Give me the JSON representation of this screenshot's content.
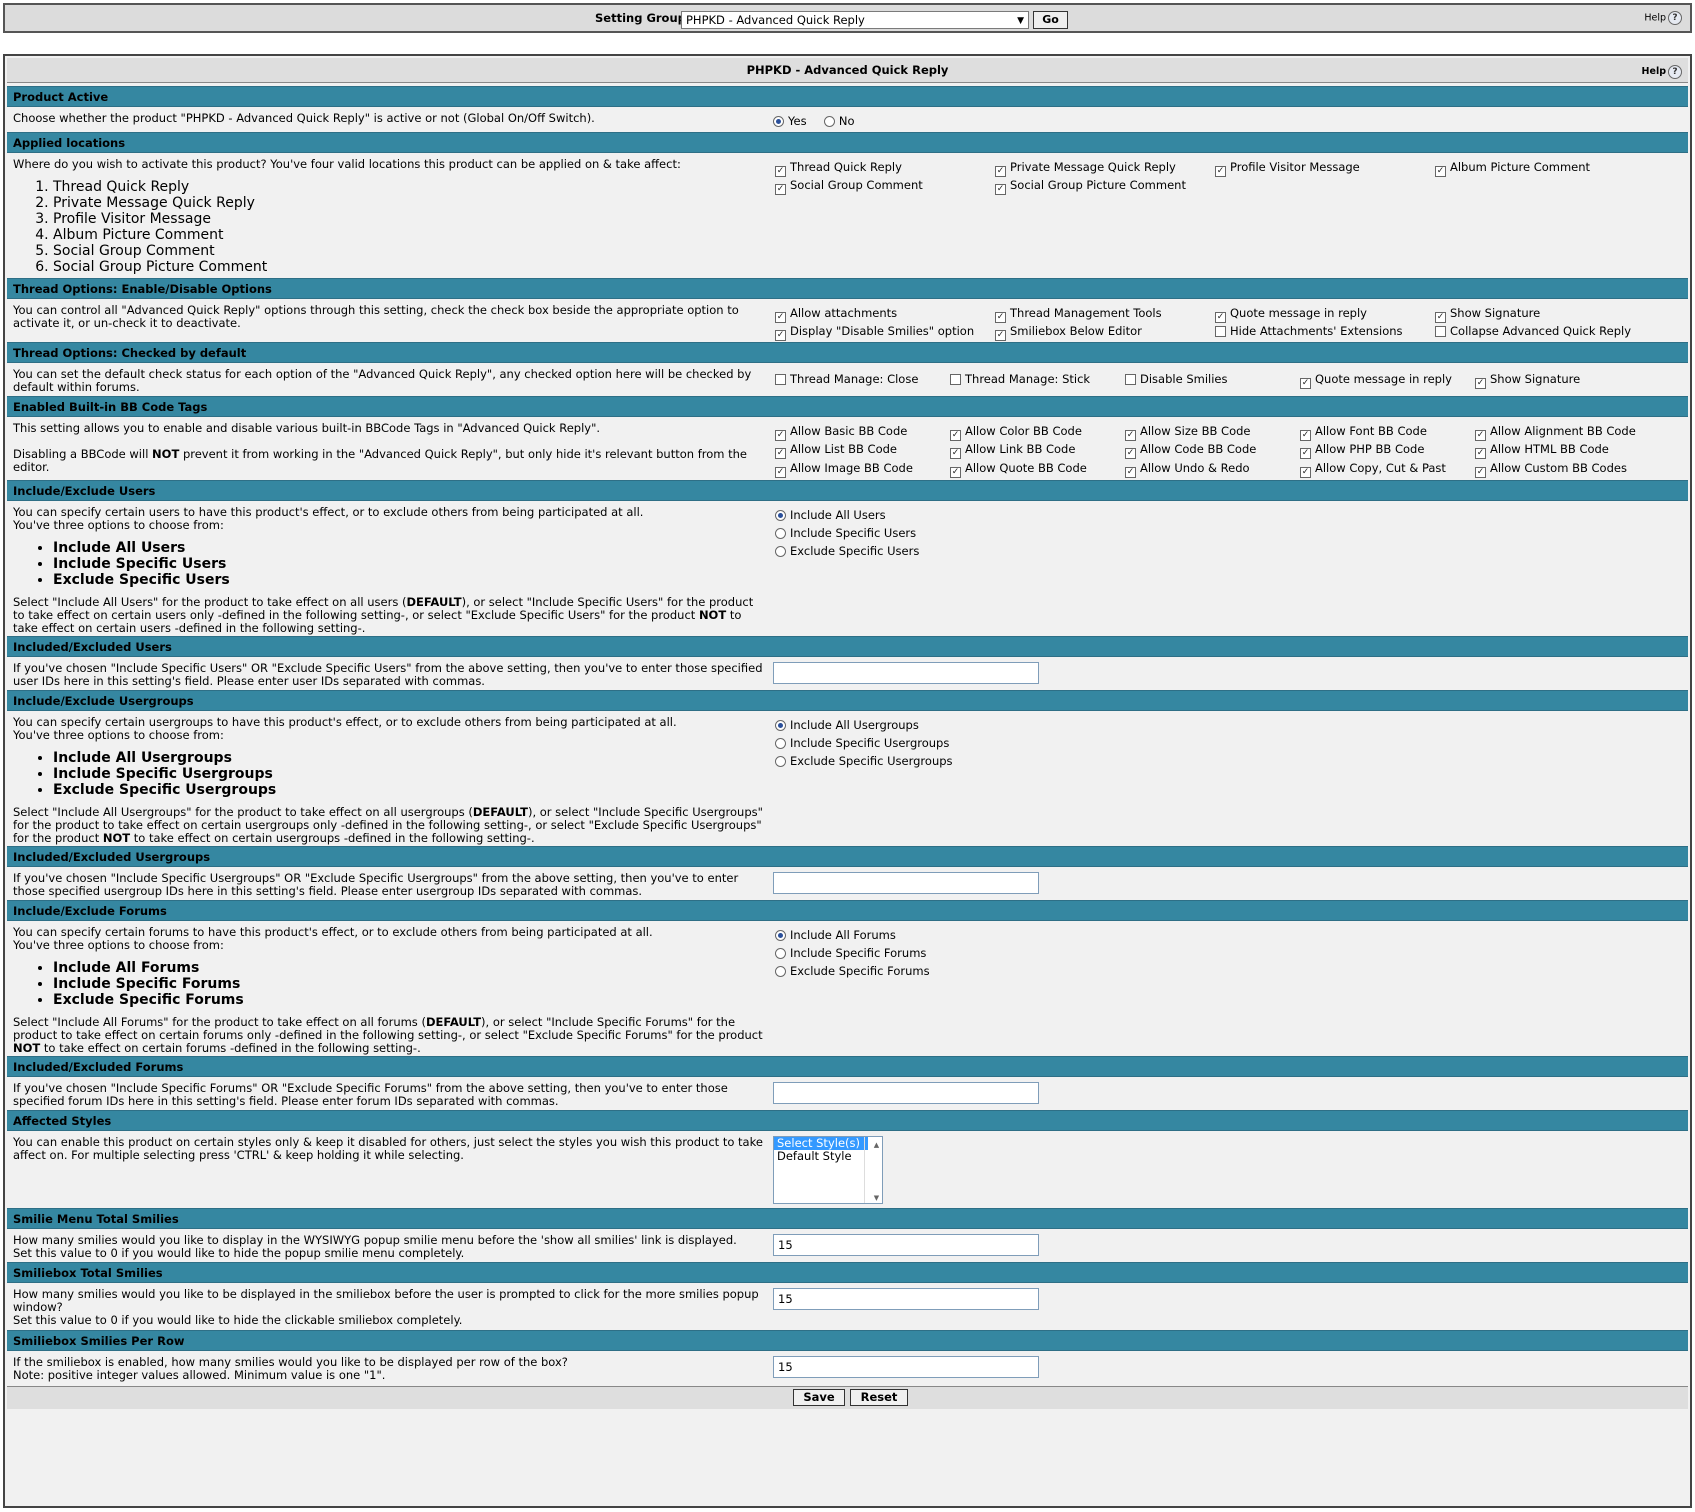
{
  "top": {
    "setting_group_label": "Setting Group",
    "selected_group": "PHPKD - Advanced Quick Reply",
    "go_label": "Go",
    "help_label": "Help"
  },
  "panel": {
    "title": "PHPKD - Advanced Quick Reply",
    "help_label": "Help"
  },
  "s1": {
    "title": "Product Active",
    "desc": "Choose whether the product \"PHPKD - Advanced Quick Reply\" is active or not (Global On/Off Switch).",
    "yes": "Yes",
    "no": "No"
  },
  "s2": {
    "title": "Applied locations",
    "desc": "Where do you wish to activate this product? You've four valid locations this product can be applied on & take affect:",
    "list": [
      "Thread Quick Reply",
      "Private Message Quick Reply",
      "Profile Visitor Message",
      "Album Picture Comment",
      "Social Group Comment",
      "Social Group Picture Comment"
    ],
    "opts": [
      "Thread Quick Reply",
      "Private Message Quick Reply",
      "Profile Visitor Message",
      "Album Picture Comment",
      "Social Group Comment",
      "Social Group Picture Comment"
    ]
  },
  "s3": {
    "title": "Thread Options: Enable/Disable Options",
    "desc": "You can control all \"Advanced Quick Reply\" options through this setting, check the check box beside the appropriate option to activate it, or un-check it to deactivate.",
    "opts": [
      "Allow attachments",
      "Thread Management Tools",
      "Quote message in reply",
      "Show Signature",
      "Display \"Disable Smilies\" option",
      "Smiliebox Below Editor",
      "Hide Attachments' Extensions",
      "Collapse Advanced Quick Reply"
    ]
  },
  "s4": {
    "title": "Thread Options: Checked by default",
    "desc": "You can set the default check status for each option of the \"Advanced Quick Reply\", any checked option here will be checked by default within forums.",
    "opts": [
      "Thread Manage: Close",
      "Thread Manage: Stick",
      "Disable Smilies",
      "Quote message in reply",
      "Show Signature"
    ]
  },
  "s5": {
    "title": "Enabled Built-in BB Code Tags",
    "desc1": "This setting allows you to enable and disable various built-in BBCode Tags in \"Advanced Quick Reply\".",
    "desc2a": "Disabling a BBCode will ",
    "desc2b": "NOT",
    "desc2c": " prevent it from working in the \"Advanced Quick Reply\", but only hide it's relevant button from the editor.",
    "opts": [
      "Allow Basic BB Code",
      "Allow Color BB Code",
      "Allow Size BB Code",
      "Allow Font BB Code",
      "Allow Alignment BB Code",
      "Allow List BB Code",
      "Allow Link BB Code",
      "Allow Code BB Code",
      "Allow PHP BB Code",
      "Allow HTML BB Code",
      "Allow Image BB Code",
      "Allow Quote BB Code",
      "Allow Undo & Redo",
      "Allow Copy, Cut & Past",
      "Allow Custom BB Codes"
    ]
  },
  "s6": {
    "title": "Include/Exclude Users",
    "desc1": "You can specify certain users to have this product's effect, or to exclude others from being participated at all.",
    "desc2": "You've three options to choose from:",
    "list": [
      "Include All Users",
      "Include Specific Users",
      "Exclude Specific Users"
    ],
    "f1": "Select \"Include All Users\" for the product to take effect on all users (",
    "f2": "DEFAULT",
    "f3": "), or select \"Include Specific Users\" for the product to take effect on certain users only -defined in the following setting-, or select \"Exclude Specific Users\" for the product ",
    "f4": "NOT",
    "f5": " to take effect on certain users -defined in the following setting-.",
    "opts": [
      "Include All Users",
      "Include Specific Users",
      "Exclude Specific Users"
    ]
  },
  "s7": {
    "title": "Included/Excluded Users",
    "desc": "If you've chosen \"Include Specific Users\" OR \"Exclude Specific Users\" from the above setting, then you've to enter those specified user IDs here in this setting's field. Please enter user IDs separated with commas.",
    "value": ""
  },
  "s8": {
    "title": "Include/Exclude Usergroups",
    "desc1": "You can specify certain usergroups to have this product's effect, or to exclude others from being participated at all.",
    "desc2": "You've three options to choose from:",
    "list": [
      "Include All Usergroups",
      "Include Specific Usergroups",
      "Exclude Specific Usergroups"
    ],
    "f1": "Select \"Include All Usergroups\" for the product to take effect on all usergroups (",
    "f2": "DEFAULT",
    "f3": "), or select \"Include Specific Usergroups\" for the product to take effect on certain usergroups only -defined in the following setting-, or select \"Exclude Specific Usergroups\" for the product ",
    "f4": "NOT",
    "f5": " to take effect on certain usergroups -defined in the following setting-.",
    "opts": [
      "Include All Usergroups",
      "Include Specific Usergroups",
      "Exclude Specific Usergroups"
    ]
  },
  "s9": {
    "title": "Included/Excluded Usergroups",
    "desc": "If you've chosen \"Include Specific Usergroups\" OR \"Exclude Specific Usergroups\" from the above setting, then you've to enter those specified usergroup IDs here in this setting's field. Please enter usergroup IDs separated with commas.",
    "value": ""
  },
  "s10": {
    "title": "Include/Exclude Forums",
    "desc1": "You can specify certain forums to have this product's effect, or to exclude others from being participated at all.",
    "desc2": "You've three options to choose from:",
    "list": [
      "Include All Forums",
      "Include Specific Forums",
      "Exclude Specific Forums"
    ],
    "f1": "Select \"Include All Forums\" for the product to take effect on all forums (",
    "f2": "DEFAULT",
    "f3": "), or select \"Include Specific Forums\" for the product to take effect on certain forums only -defined in the following setting-, or select \"Exclude Specific Forums\" for the product ",
    "f4": "NOT",
    "f5": " to take effect on certain forums -defined in the following setting-.",
    "opts": [
      "Include All Forums",
      "Include Specific Forums",
      "Exclude Specific Forums"
    ]
  },
  "s11": {
    "title": "Included/Excluded Forums",
    "desc": "If you've chosen \"Include Specific Forums\" OR \"Exclude Specific Forums\" from the above setting, then you've to enter those specified forum IDs here in this setting's field. Please enter forum IDs separated with commas.",
    "value": ""
  },
  "s12": {
    "title": "Affected Styles",
    "desc": "You can enable this product on certain styles only & keep it disabled for others, just select the styles you wish this product to take affect on. For multiple selecting press 'CTRL' & keep holding it while selecting.",
    "options": [
      "Select Style(s)",
      "Default Style"
    ]
  },
  "s13": {
    "title": "Smilie Menu Total Smilies",
    "desc1": "How many smilies would you like to display in the WYSIWYG popup smilie menu before the 'show all smilies' link is displayed.",
    "desc2": "Set this value to 0 if you would like to hide the popup smilie menu completely.",
    "value": "15"
  },
  "s14": {
    "title": "Smiliebox Total Smilies",
    "desc1": "How many smilies would you like to be displayed in the smiliebox before the user is prompted to click for the more smilies popup window?",
    "desc2": "Set this value to 0 if you would like to hide the clickable smiliebox completely.",
    "value": "15"
  },
  "s15": {
    "title": "Smiliebox Smilies Per Row",
    "desc1": "If the smiliebox is enabled, how many smilies would you like to be displayed per row of the box?",
    "desc2": "Note: positive integer values allowed. Minimum value is one \"1\".",
    "value": "15"
  },
  "footer": {
    "save": "Save",
    "reset": "Reset"
  }
}
